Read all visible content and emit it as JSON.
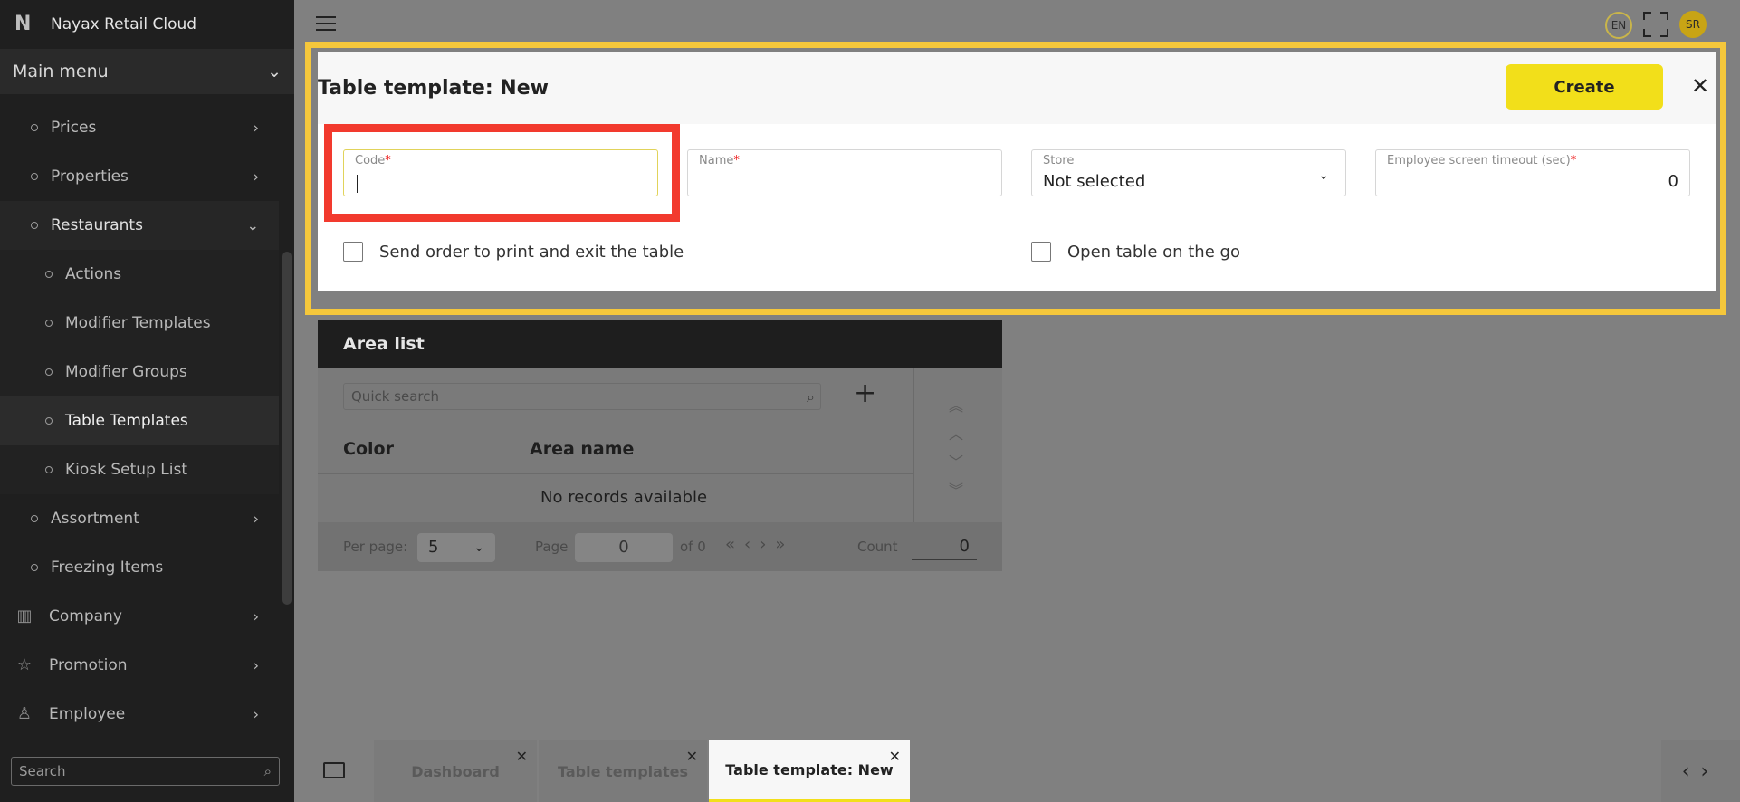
{
  "app": {
    "title": "Nayax Retail Cloud",
    "logo_letter": "N"
  },
  "sidebar": {
    "main_menu_label": "Main menu",
    "items": [
      {
        "label": "Prices"
      },
      {
        "label": "Properties"
      },
      {
        "label": "Restaurants"
      },
      {
        "label": "Actions"
      },
      {
        "label": "Modifier Templates"
      },
      {
        "label": "Modifier Groups"
      },
      {
        "label": "Table Templates"
      },
      {
        "label": "Kiosk Setup List"
      },
      {
        "label": "Assortment"
      },
      {
        "label": "Freezing Items"
      },
      {
        "label": "Company"
      },
      {
        "label": "Promotion"
      },
      {
        "label": "Employee"
      }
    ],
    "search_placeholder": "Search"
  },
  "topbar": {
    "language": "EN",
    "user_initials": "SR"
  },
  "form": {
    "title": "Table template: New",
    "create_label": "Create",
    "fields": {
      "code": {
        "label": "Code",
        "value": ""
      },
      "name": {
        "label": "Name",
        "value": ""
      },
      "store": {
        "label": "Store",
        "value": "Not selected"
      },
      "timeout": {
        "label": "Employee screen timeout (sec)",
        "value": "0"
      }
    },
    "required_mark": "*",
    "checkboxes": {
      "send_order": {
        "label": "Send order to print and exit the table",
        "checked": false
      },
      "open_on_go": {
        "label": "Open table on the go",
        "checked": false
      }
    }
  },
  "area_list": {
    "title": "Area list",
    "search_placeholder": "Quick search",
    "columns": [
      "Color",
      "Area name"
    ],
    "empty_text": "No records available",
    "footer": {
      "per_page_label": "Per page:",
      "per_page_value": "5",
      "page_label": "Page",
      "page_value": "0",
      "of_label": "of 0",
      "count_label": "Count",
      "count_value": "0"
    }
  },
  "tabs": [
    {
      "label": "Dashboard",
      "active": false
    },
    {
      "label": "Table templates",
      "active": false
    },
    {
      "label": "Table template: New",
      "active": true
    }
  ],
  "colors": {
    "accent": "#f2df1a",
    "highlight_border": "#f5c73b",
    "focus_outline": "#f23a2e",
    "sidebar_bg": "#1f1f1f"
  }
}
